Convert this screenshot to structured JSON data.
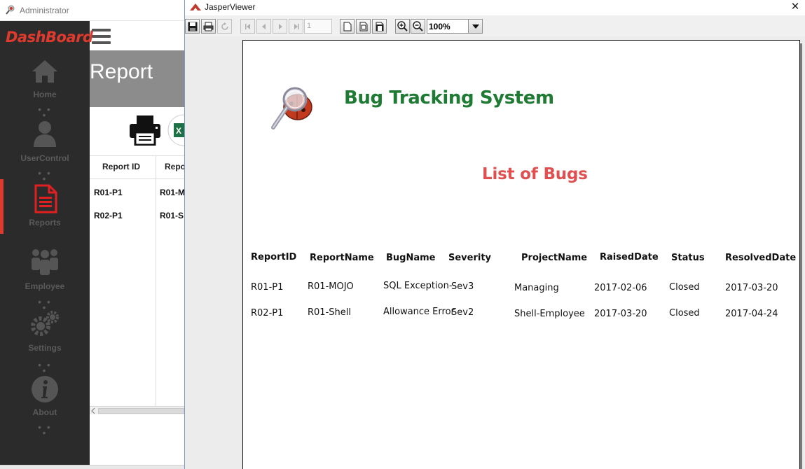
{
  "admin_window": {
    "title": "Administrator",
    "brand": "DashBoard",
    "nav": [
      {
        "label": "Home",
        "icon": "home-icon"
      },
      {
        "label": "UserControl",
        "icon": "user-icon"
      },
      {
        "label": "Reports",
        "icon": "report-document-icon"
      },
      {
        "label": "Employee",
        "icon": "group-icon"
      },
      {
        "label": "Settings",
        "icon": "gears-icon"
      },
      {
        "label": "About",
        "icon": "info-icon"
      }
    ],
    "nav_dots": "• • •",
    "page_title": "Report",
    "table": {
      "headers": [
        "Report ID",
        "Repo"
      ],
      "rows": [
        [
          "R01-P1",
          "R01-M"
        ],
        [
          "R02-P1",
          "R01-S"
        ]
      ]
    },
    "colors": {
      "sidebar": "#2b2b2b",
      "accent": "#e03a2e",
      "header": "#8c8c8c"
    }
  },
  "viewer": {
    "title": "JasperViewer",
    "close_glyph": "✕",
    "page_number": "1",
    "zoom": "100%",
    "report": {
      "title": "Bug Tracking System",
      "subtitle": "List of Bugs",
      "columns": [
        "ReportID",
        "ReportName",
        "BugName",
        "Severity",
        "ProjectName",
        "RaisedDate",
        "Status",
        "ResolvedDate"
      ],
      "rows": [
        [
          "R01-P1",
          "R01-MOJO",
          "SQL Exception-",
          "Sev3",
          "Managing",
          "2017-02-06",
          "Closed",
          "2017-03-20"
        ],
        [
          "R02-P1",
          "R01-Shell",
          "Allowance Error",
          "Sev2",
          "Shell-Employee",
          "2017-03-20",
          "Closed",
          "2017-04-24"
        ]
      ]
    },
    "colors": {
      "title": "#1f7a33",
      "subtitle": "#e05050"
    }
  }
}
